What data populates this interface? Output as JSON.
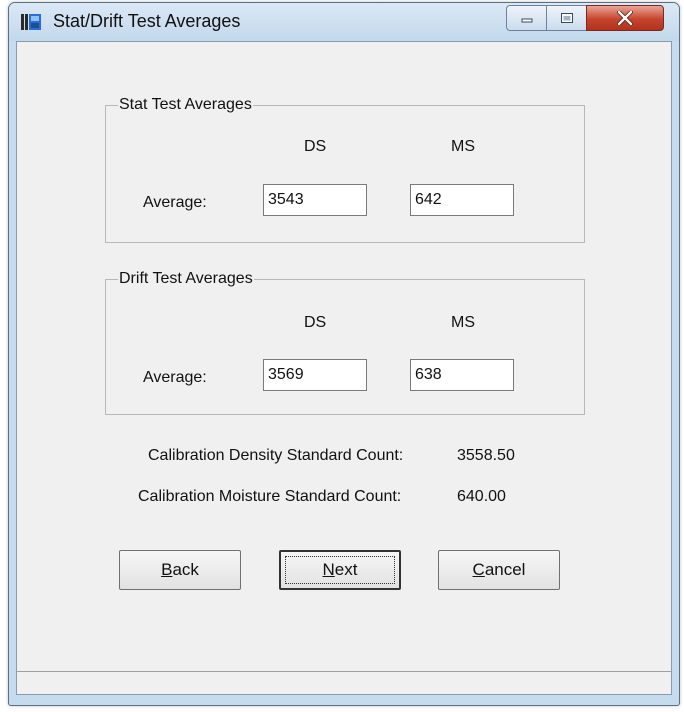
{
  "window": {
    "title": "Stat/Drift Test Averages",
    "icon": "app-bars-icon",
    "controls": {
      "minimize": "minimize-icon",
      "maximize": "maximize-icon",
      "close": "close-icon"
    }
  },
  "stat_group": {
    "label": "Stat Test Averages",
    "col_ds": "DS",
    "col_ms": "MS",
    "row_label": "Average:",
    "ds_value": "3543",
    "ms_value": "642"
  },
  "drift_group": {
    "label": "Drift Test Averages",
    "col_ds": "DS",
    "col_ms": "MS",
    "row_label": "Average:",
    "ds_value": "3569",
    "ms_value": "638"
  },
  "calibration": {
    "density_label": "Calibration Density Standard Count:",
    "density_value": "3558.50",
    "moisture_label": "Calibration Moisture Standard Count:",
    "moisture_value": "640.00"
  },
  "buttons": {
    "back": {
      "accel": "B",
      "rest": "ack"
    },
    "next": {
      "accel": "N",
      "rest": "ext"
    },
    "cancel": {
      "accel": "C",
      "rest": "ancel"
    }
  },
  "colors": {
    "window_frame": "#c7dbee",
    "client_bg": "#f0f0f0",
    "close_button": "#c6442d"
  }
}
